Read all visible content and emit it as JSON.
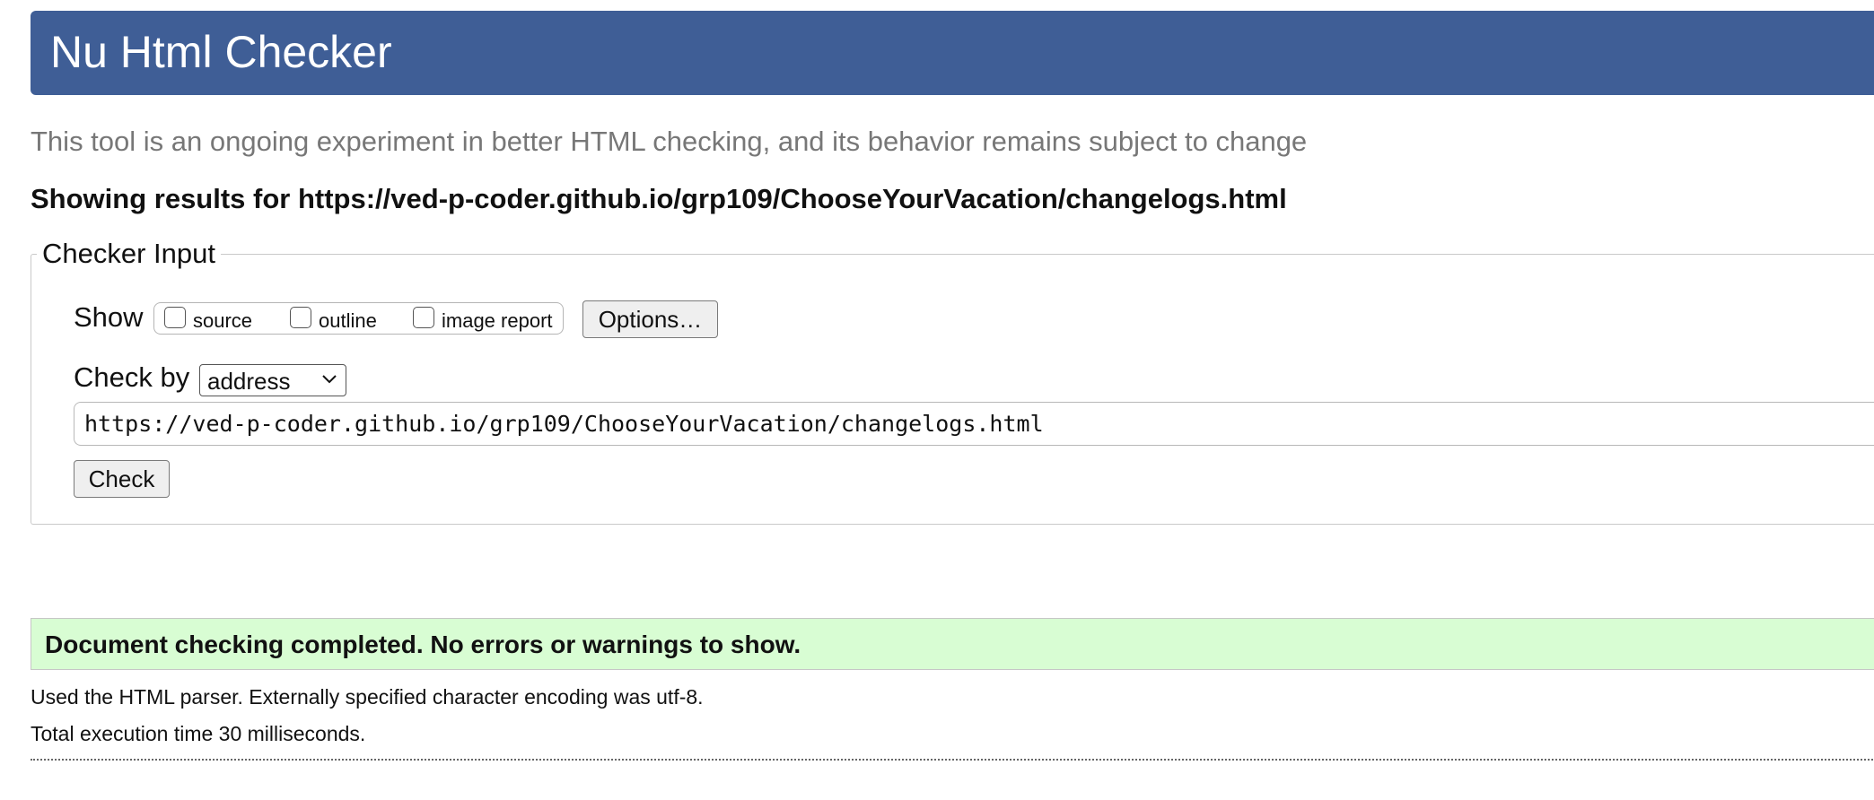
{
  "header": {
    "title": "Nu Html Checker",
    "bar_color": "#3f5e96"
  },
  "subtitle": "This tool is an ongoing experiment in better HTML checking, and its behavior remains subject to change",
  "results_heading": "Showing results for https://ved-p-coder.github.io/grp109/ChooseYourVacation/changelogs.html",
  "checker_input": {
    "legend": "Checker Input",
    "show_label": "Show",
    "show_options": [
      {
        "label": "source",
        "checked": false
      },
      {
        "label": "outline",
        "checked": false
      },
      {
        "label": "image report",
        "checked": false
      }
    ],
    "options_button": "Options…",
    "check_by_label": "Check by",
    "check_by_selected": "address",
    "url_value": "https://ved-p-coder.github.io/grp109/ChooseYourVacation/changelogs.html",
    "check_button": "Check"
  },
  "result": {
    "message": "Document checking completed. No errors or warnings to show.",
    "background_color": "#d8fdd3"
  },
  "footer_info": {
    "parser": "Used the HTML parser. Externally specified character encoding was utf-8.",
    "execution_time": "Total execution time 30 milliseconds."
  }
}
